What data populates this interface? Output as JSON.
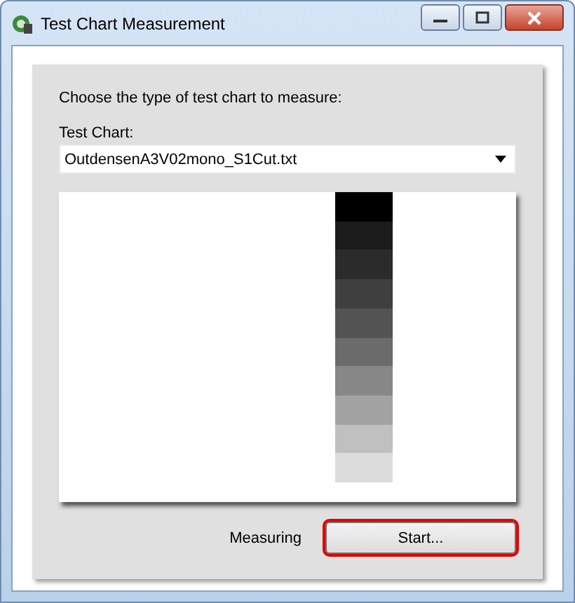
{
  "window": {
    "title": "Test Chart Measurement"
  },
  "prompt": "Choose the type of test chart to measure:",
  "test_chart": {
    "label": "Test Chart:",
    "value": "OutdensenA3V02mono_S1Cut.txt"
  },
  "patches": [
    {
      "color": "#000000"
    },
    {
      "color": "#1b1b1b"
    },
    {
      "color": "#2b2b2b"
    },
    {
      "color": "#3f3f3f"
    },
    {
      "color": "#535353"
    },
    {
      "color": "#6b6b6b"
    },
    {
      "color": "#878787"
    },
    {
      "color": "#a3a3a3"
    },
    {
      "color": "#c0c0c0"
    },
    {
      "color": "#dcdcdc"
    }
  ],
  "status": "Measuring",
  "start_button": {
    "label": "Start...",
    "focused": true
  }
}
